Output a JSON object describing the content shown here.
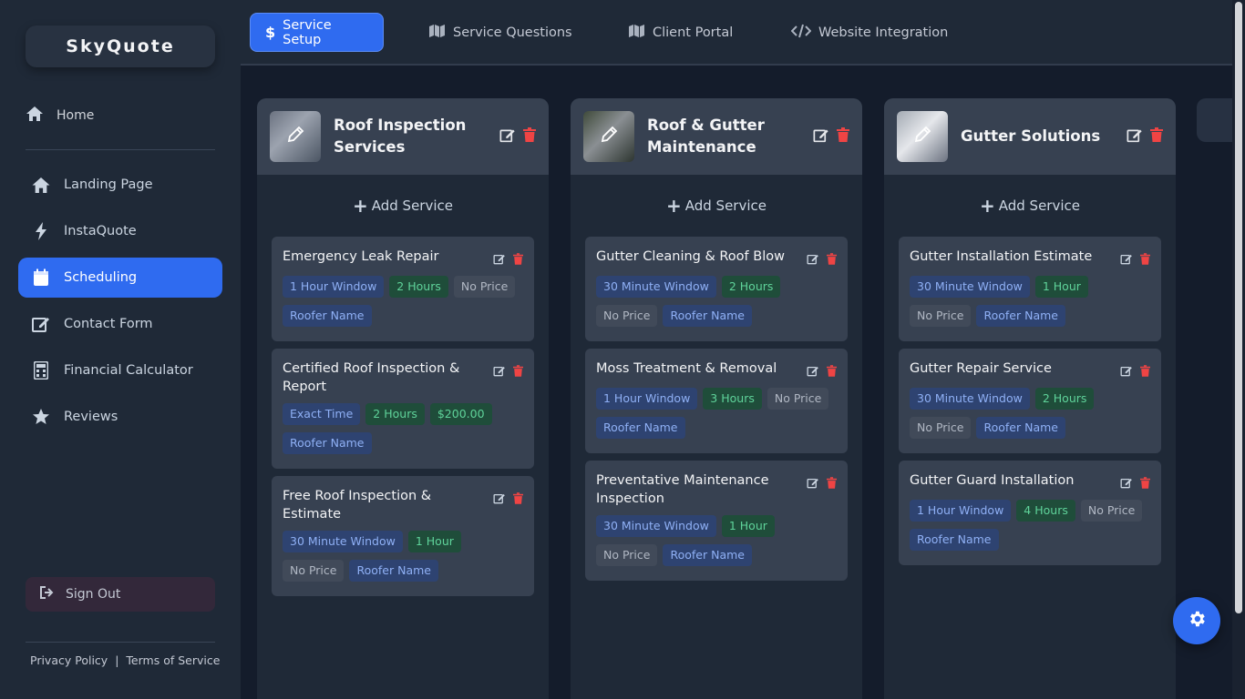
{
  "app": {
    "name": "SkyQuote"
  },
  "sidebar": {
    "home": "Home",
    "items": [
      {
        "label": "Landing Page",
        "icon": "home-icon"
      },
      {
        "label": "InstaQuote",
        "icon": "bolt-icon"
      },
      {
        "label": "Scheduling",
        "icon": "calendar-icon",
        "active": true
      },
      {
        "label": "Contact Form",
        "icon": "edit-icon"
      },
      {
        "label": "Financial Calculator",
        "icon": "calculator-icon"
      },
      {
        "label": "Reviews",
        "icon": "star-icon"
      }
    ],
    "sign_out": "Sign Out",
    "privacy": "Privacy Policy",
    "separator": "|",
    "terms": "Terms of Service"
  },
  "tabs": [
    {
      "label": "Service Setup",
      "icon": "dollar-icon",
      "active": true
    },
    {
      "label": "Service Questions",
      "icon": "map-icon"
    },
    {
      "label": "Client Portal",
      "icon": "map-icon"
    },
    {
      "label": "Website Integration",
      "icon": "code-icon"
    }
  ],
  "add_service_label": "Add Service",
  "columns": [
    {
      "title": "Roof Inspection Services",
      "cards": [
        {
          "title": "Emergency Leak Repair",
          "window": "1 Hour Window",
          "duration": "2 Hours",
          "price": "No Price",
          "staff": "Roofer Name"
        },
        {
          "title": "Certified Roof Inspection & Report",
          "window": "Exact Time",
          "duration": "2 Hours",
          "price": "$200.00",
          "staff": "Roofer Name"
        },
        {
          "title": "Free Roof Inspection & Estimate",
          "window": "30 Minute Window",
          "duration": "1 Hour",
          "price": "No Price",
          "staff": "Roofer Name"
        }
      ]
    },
    {
      "title": "Roof & Gutter Maintenance",
      "cards": [
        {
          "title": "Gutter Cleaning & Roof Blow",
          "window": "30 Minute Window",
          "duration": "2 Hours",
          "price": "No Price",
          "staff": "Roofer Name"
        },
        {
          "title": "Moss Treatment & Removal",
          "window": "1 Hour Window",
          "duration": "3 Hours",
          "price": "No Price",
          "staff": "Roofer Name"
        },
        {
          "title": "Preventative Maintenance Inspection",
          "window": "30 Minute Window",
          "duration": "1 Hour",
          "price": "No Price",
          "staff": "Roofer Name"
        }
      ]
    },
    {
      "title": "Gutter Solutions",
      "cards": [
        {
          "title": "Gutter Installation Estimate",
          "window": "30 Minute Window",
          "duration": "1 Hour",
          "price": "No Price",
          "staff": "Roofer Name"
        },
        {
          "title": "Gutter Repair Service",
          "window": "30 Minute Window",
          "duration": "2 Hours",
          "price": "No Price",
          "staff": "Roofer Name"
        },
        {
          "title": "Gutter Guard Installation",
          "window": "1 Hour Window",
          "duration": "4 Hours",
          "price": "No Price",
          "staff": "Roofer Name"
        }
      ]
    }
  ],
  "colors": {
    "accent": "#2f6bf0",
    "delete": "#ef4444",
    "sidebar": "#1f2937",
    "background": "#141c2b"
  }
}
